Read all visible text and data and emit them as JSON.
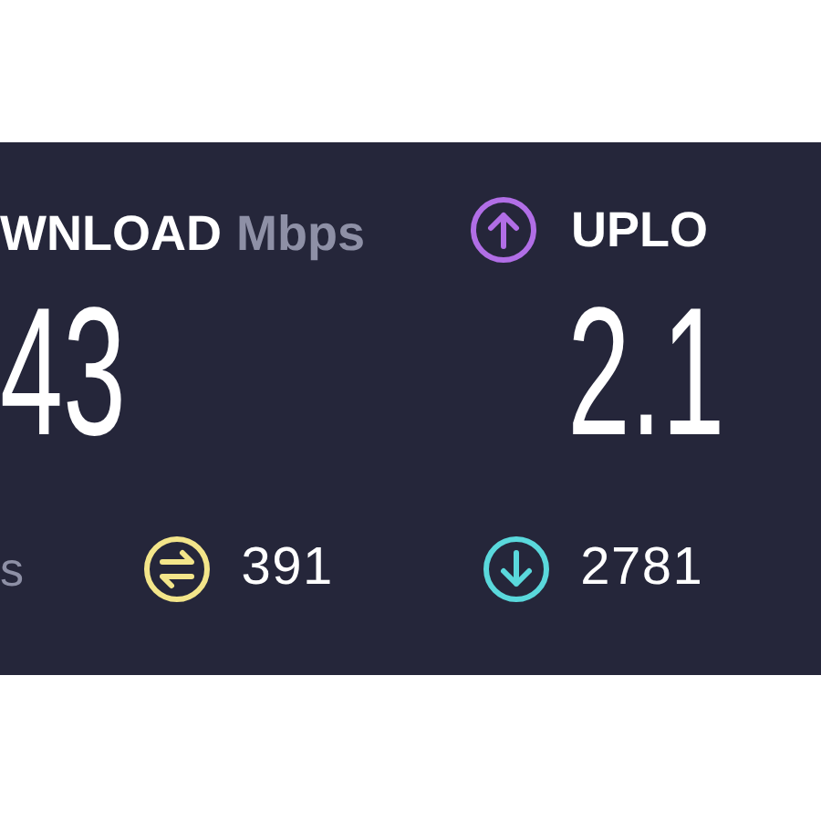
{
  "download": {
    "label": "WNLOAD",
    "unit": "Mbps",
    "value": "43"
  },
  "upload": {
    "label": "UPLO",
    "value": "2.1"
  },
  "stats": [
    {
      "kind": "unit",
      "text": "s"
    },
    {
      "kind": "jitter",
      "text": "391",
      "color": "#f3e58a"
    },
    {
      "kind": "download",
      "text": "2781",
      "color": "#5ad8dc"
    }
  ]
}
